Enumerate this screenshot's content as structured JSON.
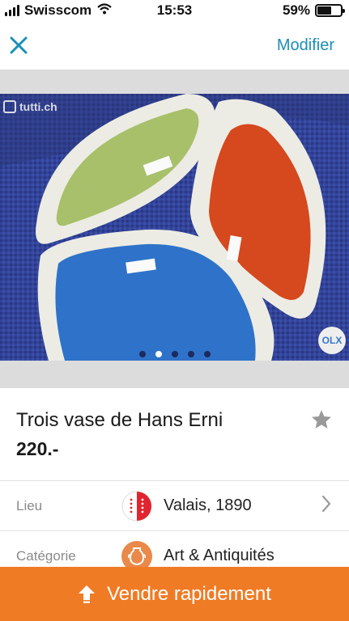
{
  "status_bar": {
    "carrier": "Swisscom",
    "time": "15:53",
    "battery": "59%",
    "battery_level": 0.59
  },
  "nav": {
    "modify_label": "Modifier",
    "accent_color": "#1a8fb6"
  },
  "gallery": {
    "watermark": "tutti.ch",
    "badge": "OLX",
    "image_count": 5,
    "active_index": 1
  },
  "listing": {
    "title": "Trois vase de Hans Erni",
    "price": "220.-"
  },
  "details": [
    {
      "label": "Lieu",
      "value": "Valais, 1890",
      "icon": "valais-flag-icon"
    },
    {
      "label": "Catégorie",
      "value": "Art & Antiquités",
      "icon": "vase-icon"
    }
  ],
  "sell_button": {
    "label": "Vendre rapidement",
    "color": "#f07b25"
  }
}
